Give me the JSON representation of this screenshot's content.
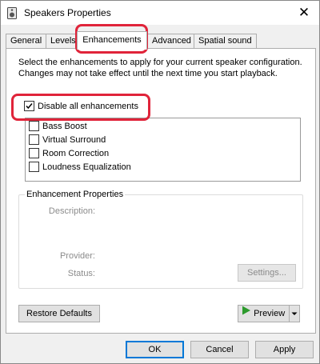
{
  "window": {
    "title": "Speakers Properties",
    "close_glyph": "✕"
  },
  "tabs": [
    {
      "label": "General",
      "active": false
    },
    {
      "label": "Levels",
      "active": false
    },
    {
      "label": "Enhancements",
      "active": true
    },
    {
      "label": "Advanced",
      "active": false
    },
    {
      "label": "Spatial sound",
      "active": false
    }
  ],
  "enhancements": {
    "description": "Select the enhancements to apply for your current speaker configuration. Changes may not take effect until the next time you start playback.",
    "disable_all": {
      "label": "Disable all enhancements",
      "checked": true
    },
    "items": [
      {
        "label": "Bass Boost",
        "checked": false
      },
      {
        "label": "Virtual Surround",
        "checked": false
      },
      {
        "label": "Room Correction",
        "checked": false
      },
      {
        "label": "Loudness Equalization",
        "checked": false
      }
    ]
  },
  "properties": {
    "title": "Enhancement Properties",
    "description_label": "Description:",
    "provider_label": "Provider:",
    "status_label": "Status:",
    "settings_button": "Settings..."
  },
  "buttons": {
    "restore_defaults": "Restore Defaults",
    "preview": "Preview",
    "ok": "OK",
    "cancel": "Cancel",
    "apply": "Apply"
  },
  "colors": {
    "highlight": "#e0243a",
    "accent": "#0078d7",
    "preview_play": "#2c9a2c"
  },
  "icons": {
    "title_icon": "speaker-icon",
    "preview_icon": "play-icon",
    "dropdown_icon": "chevron-down-icon"
  }
}
